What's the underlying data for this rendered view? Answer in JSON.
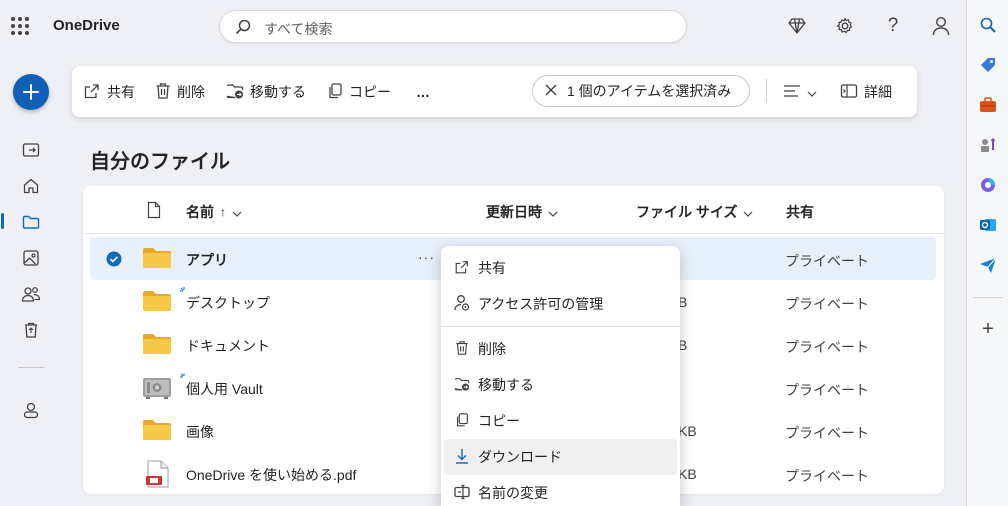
{
  "app": {
    "brand": "OneDrive"
  },
  "search": {
    "placeholder": "すべて検索"
  },
  "toolbar": {
    "share": "共有",
    "delete": "削除",
    "move": "移動する",
    "copy": "コピー",
    "more": "…",
    "selection": "1 個のアイテムを選択済み",
    "details": "詳細"
  },
  "page": {
    "title": "自分のファイル"
  },
  "columns": {
    "name": "名前",
    "sort_arrow": "↑",
    "modified": "更新日時",
    "size": "ファイル サイズ",
    "sharing": "共有"
  },
  "files": [
    {
      "name": "アプリ",
      "size": "",
      "sharing": "プライベート",
      "type": "folder",
      "selected": true
    },
    {
      "name": "デスクトップ",
      "size": "B",
      "sharing": "プライベート",
      "type": "folder",
      "selected": false
    },
    {
      "name": "ドキュメント",
      "size": "B",
      "sharing": "プライベート",
      "type": "folder",
      "selected": false
    },
    {
      "name": "個人用 Vault",
      "size": "",
      "sharing": "プライベート",
      "type": "vault",
      "selected": false
    },
    {
      "name": "画像",
      "size": "KB",
      "sharing": "プライベート",
      "type": "folder",
      "selected": false
    },
    {
      "name": "OneDrive を使い始める.pdf",
      "size": "KB",
      "sharing": "プライベート",
      "type": "pdf",
      "selected": false
    }
  ],
  "row_more": "···",
  "context_menu": [
    {
      "label": "共有",
      "icon": "share-icon"
    },
    {
      "label": "アクセス許可の管理",
      "icon": "manage-access-icon"
    },
    {
      "label": "削除",
      "icon": "trash-icon"
    },
    {
      "label": "移動する",
      "icon": "move-icon"
    },
    {
      "label": "コピー",
      "icon": "copy-icon"
    },
    {
      "label": "ダウンロード",
      "icon": "download-icon"
    },
    {
      "label": "名前の変更",
      "icon": "rename-icon"
    }
  ],
  "colors": {
    "accent": "#0f6cbd",
    "new_button": "#1060b8",
    "folder": "#f7c948",
    "selected_row": "#e8f0fb"
  }
}
